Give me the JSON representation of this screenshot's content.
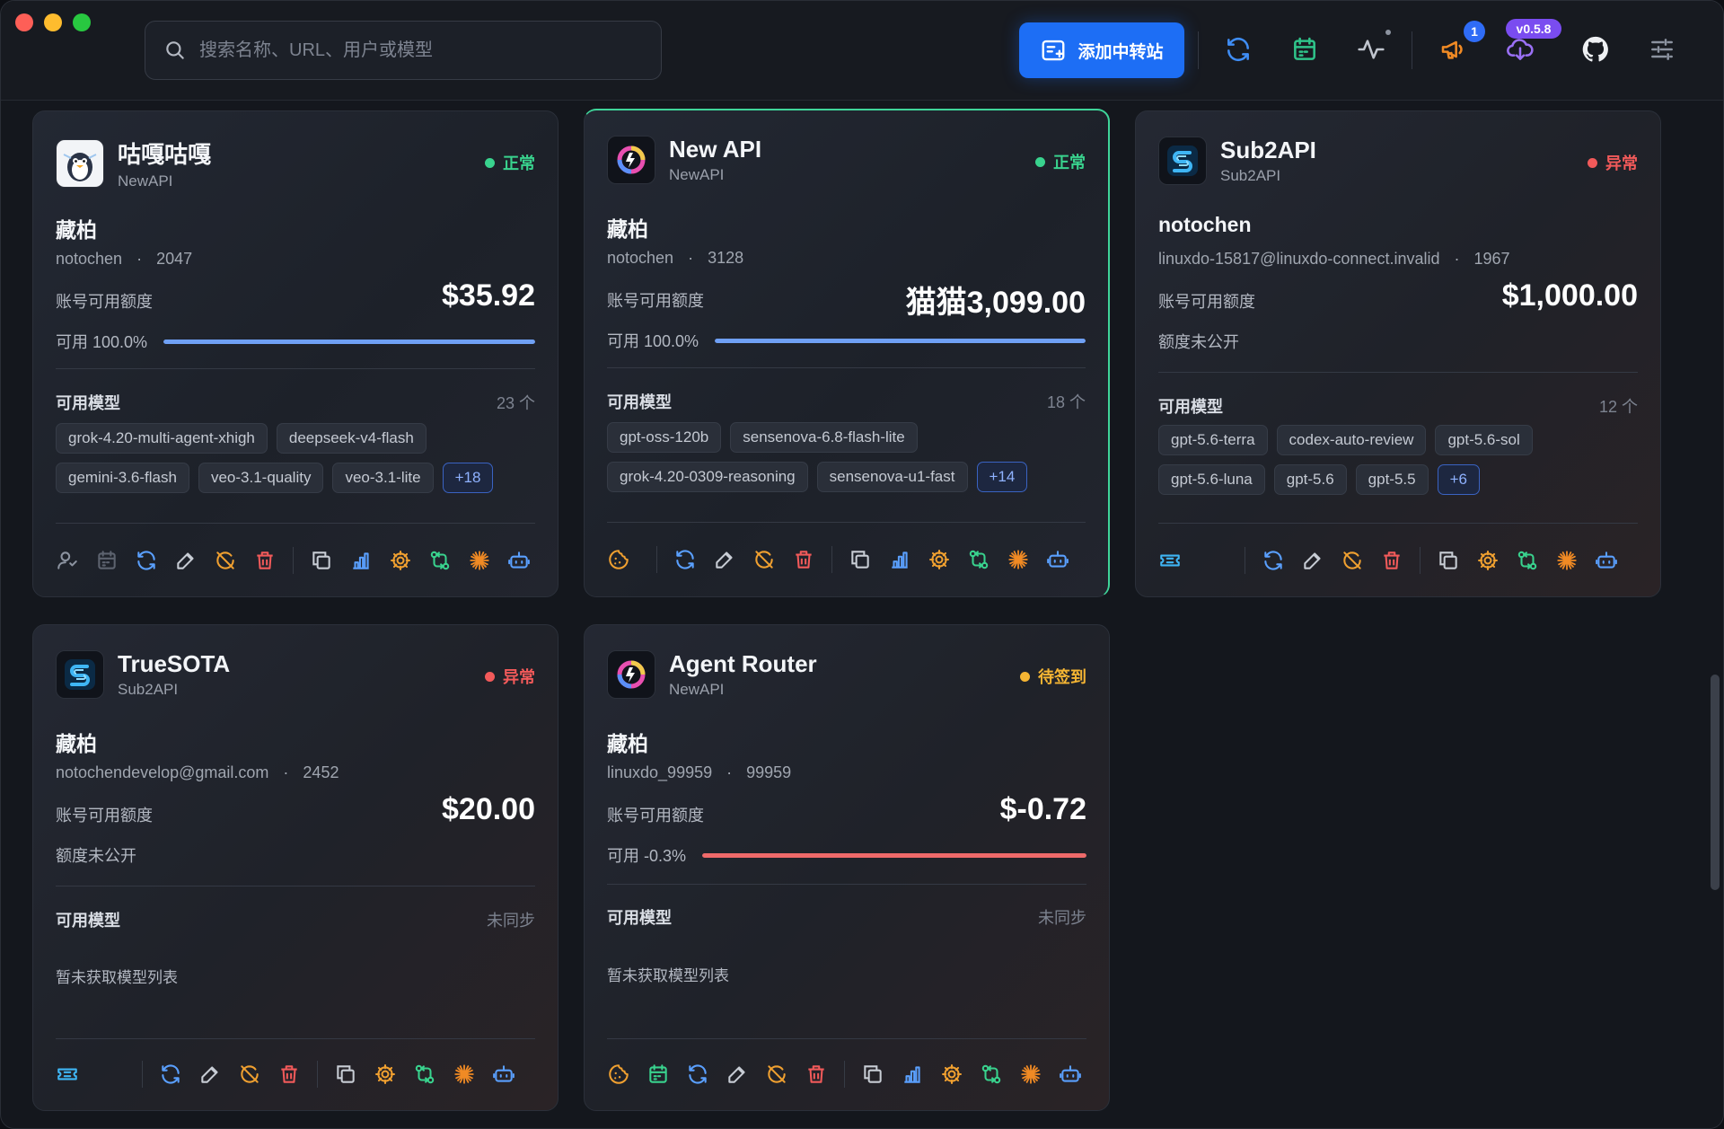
{
  "search": {
    "placeholder": "搜索名称、URL、用户或模型"
  },
  "toolbar": {
    "add_label": "添加中转站",
    "notification_count": "1",
    "version": "v0.5.8"
  },
  "colors": {
    "accent": "#1d6ef5",
    "ok": "#39d38e",
    "error": "#f25a5a",
    "pending": "#f5b533"
  },
  "cards": [
    {
      "name": "咕嘎咕嘎",
      "type": "NewAPI",
      "status": "正常",
      "owner": "藏柏",
      "account": "notochen",
      "uid": "2047",
      "quota_label": "账号可用额度",
      "quota": "$35.92",
      "usage_text": "可用 100.0%",
      "usage_pct": 100,
      "models_label": "可用模型",
      "models_count": "23 个",
      "models": [
        "grok-4.20-multi-agent-xhigh",
        "deepseek-v4-flash",
        "gemini-3.6-flash",
        "veo-3.1-quality",
        "veo-3.1-lite"
      ],
      "more": "+18"
    },
    {
      "name": "New API",
      "type": "NewAPI",
      "status": "正常",
      "owner": "藏柏",
      "account": "notochen",
      "uid": "3128",
      "quota_label": "账号可用额度",
      "quota": "猫猫3,099.00",
      "usage_text": "可用 100.0%",
      "usage_pct": 100,
      "models_label": "可用模型",
      "models_count": "18 个",
      "models": [
        "gpt-oss-120b",
        "sensenova-6.8-flash-lite",
        "grok-4.20-0309-reasoning",
        "sensenova-u1-fast"
      ],
      "more": "+14"
    },
    {
      "name": "Sub2API",
      "type": "Sub2API",
      "status": "异常",
      "owner": "notochen",
      "account": "linuxdo-15817@linuxdo-connect.invalid",
      "uid": "1967",
      "quota_label": "账号可用额度",
      "quota": "$1,000.00",
      "hidden_text": "额度未公开",
      "models_label": "可用模型",
      "models_count": "12 个",
      "models": [
        "gpt-5.6-terra",
        "codex-auto-review",
        "gpt-5.6-sol",
        "gpt-5.6-luna",
        "gpt-5.6",
        "gpt-5.5"
      ],
      "more": "+6"
    },
    {
      "name": "TrueSOTA",
      "type": "Sub2API",
      "status": "异常",
      "owner": "藏柏",
      "account": "notochendevelop@gmail.com",
      "uid": "2452",
      "quota_label": "账号可用额度",
      "quota": "$20.00",
      "hidden_text": "额度未公开",
      "models_label": "可用模型",
      "models_count": "未同步",
      "no_models": "暂未获取模型列表"
    },
    {
      "name": "Agent Router",
      "type": "NewAPI",
      "status": "待签到",
      "owner": "藏柏",
      "account": "linuxdo_99959",
      "uid": "99959",
      "quota_label": "账号可用额度",
      "quota": "$-0.72",
      "usage_text": "可用 -0.3%",
      "usage_pct": 100,
      "models_label": "可用模型",
      "models_count": "未同步",
      "no_models": "暂未获取模型列表"
    }
  ]
}
